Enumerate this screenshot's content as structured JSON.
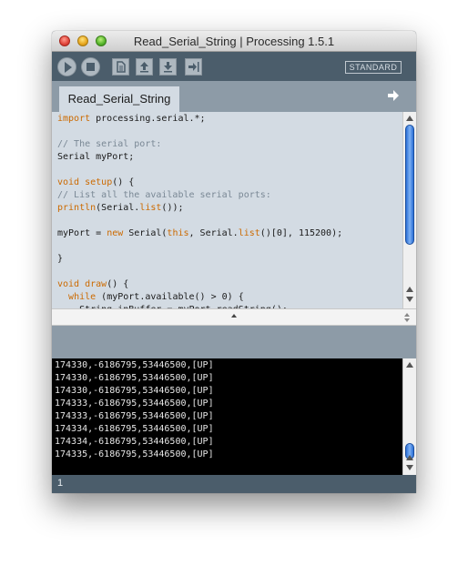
{
  "window": {
    "title": "Read_Serial_String | Processing 1.5.1"
  },
  "toolbar": {
    "buttons": [
      {
        "name": "run",
        "icon": "play-icon"
      },
      {
        "name": "stop",
        "icon": "stop-icon"
      },
      {
        "name": "new",
        "icon": "new-document-icon"
      },
      {
        "name": "open",
        "icon": "arrow-up-icon"
      },
      {
        "name": "save",
        "icon": "arrow-down-icon"
      },
      {
        "name": "export",
        "icon": "export-icon"
      }
    ],
    "mode_label": "STANDARD"
  },
  "tabs": {
    "active": "Read_Serial_String"
  },
  "editor": {
    "lines": [
      {
        "tokens": [
          {
            "t": "import",
            "c": "kw"
          },
          {
            "t": " processing.serial.*;",
            "c": ""
          }
        ]
      },
      {
        "tokens": []
      },
      {
        "tokens": [
          {
            "t": "// The serial port:",
            "c": "cm"
          }
        ]
      },
      {
        "tokens": [
          {
            "t": "Serial myPort;",
            "c": ""
          }
        ]
      },
      {
        "tokens": []
      },
      {
        "tokens": [
          {
            "t": "void",
            "c": "kw"
          },
          {
            "t": " ",
            "c": ""
          },
          {
            "t": "setup",
            "c": "fn"
          },
          {
            "t": "() {",
            "c": ""
          }
        ]
      },
      {
        "tokens": [
          {
            "t": "// List all the available serial ports:",
            "c": "cm"
          }
        ]
      },
      {
        "tokens": [
          {
            "t": "println",
            "c": "fn"
          },
          {
            "t": "(Serial.",
            "c": ""
          },
          {
            "t": "list",
            "c": "fn"
          },
          {
            "t": "());",
            "c": ""
          }
        ]
      },
      {
        "tokens": []
      },
      {
        "tokens": [
          {
            "t": "myPort = ",
            "c": ""
          },
          {
            "t": "new",
            "c": "kw"
          },
          {
            "t": " Serial(",
            "c": ""
          },
          {
            "t": "this",
            "c": "kw"
          },
          {
            "t": ", Serial.",
            "c": ""
          },
          {
            "t": "list",
            "c": "fn"
          },
          {
            "t": "()[0], 115200);",
            "c": ""
          }
        ]
      },
      {
        "tokens": []
      },
      {
        "tokens": [
          {
            "t": "}",
            "c": ""
          }
        ]
      },
      {
        "tokens": []
      },
      {
        "tokens": [
          {
            "t": "void",
            "c": "kw"
          },
          {
            "t": " ",
            "c": ""
          },
          {
            "t": "draw",
            "c": "fn"
          },
          {
            "t": "() {",
            "c": ""
          }
        ]
      },
      {
        "tokens": [
          {
            "t": "  ",
            "c": ""
          },
          {
            "t": "while",
            "c": "kw"
          },
          {
            "t": " (myPort.available() > 0) {",
            "c": ""
          }
        ]
      },
      {
        "tokens": [
          {
            "t": "    String inBuffer = myPort.readString();",
            "c": ""
          }
        ]
      }
    ]
  },
  "console": {
    "lines": [
      "174330,-6186795,53446500,[UP]",
      "174330,-6186795,53446500,[UP]",
      "174330,-6186795,53446500,[UP]",
      "174333,-6186795,53446500,[UP]",
      "174333,-6186795,53446500,[UP]",
      "174334,-6186795,53446500,[UP]",
      "174334,-6186795,53446500,[UP]",
      "174335,-6186795,53446500,[UP]"
    ]
  },
  "status": {
    "line_number": "1"
  },
  "colors": {
    "toolbar": "#4b5d6b",
    "editor_bg": "#d3dbe3",
    "keyword": "#cc6a00",
    "comment": "#7a8895",
    "console_bg": "#000000"
  }
}
